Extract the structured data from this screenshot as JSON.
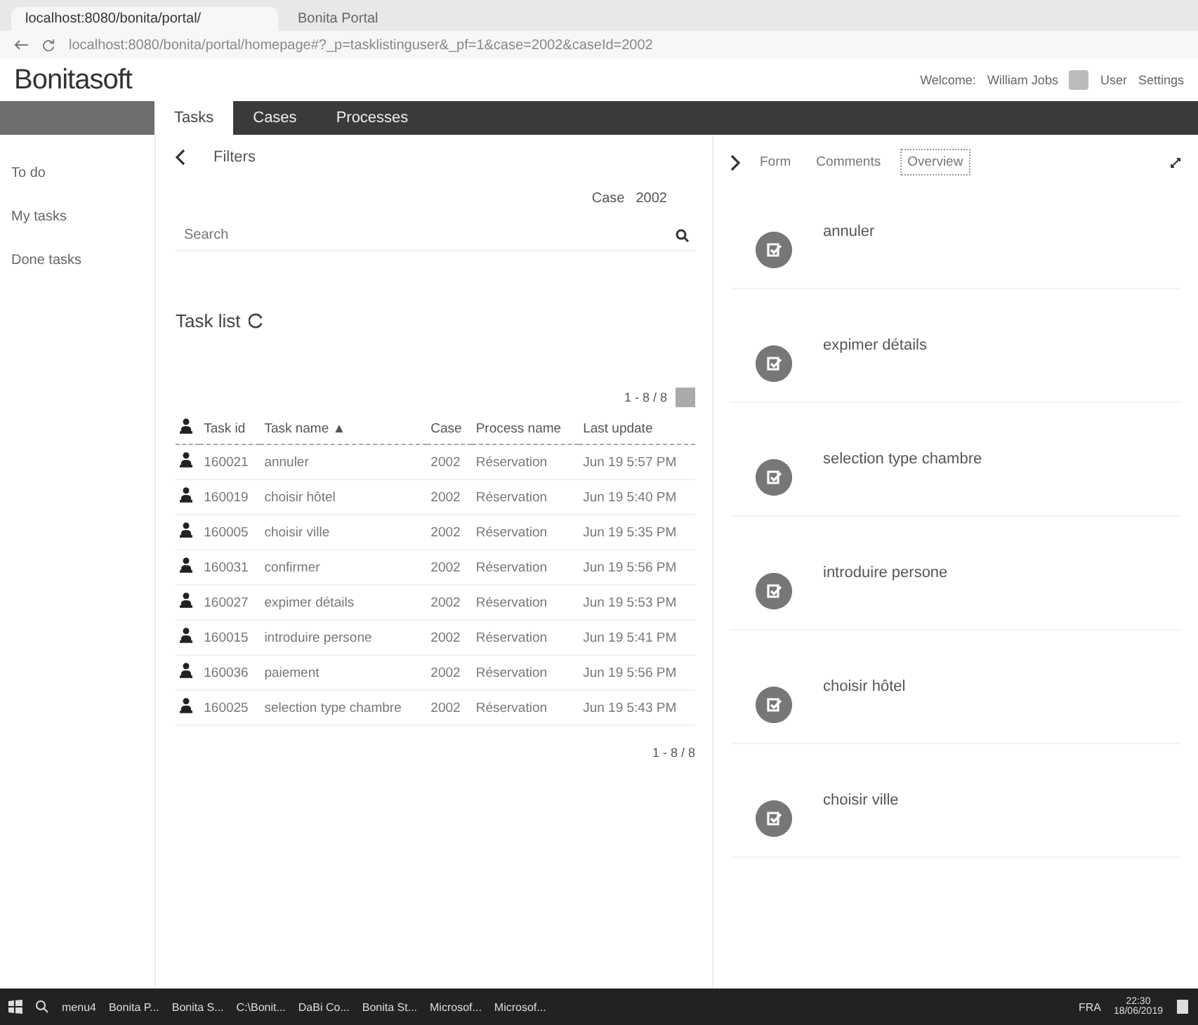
{
  "browser": {
    "tabs": [
      {
        "title": "localhost:8080/bonita/portal/",
        "selected": true
      },
      {
        "title": "Bonita Portal",
        "selected": false
      }
    ],
    "url": "localhost:8080/bonita/portal/homepage#?_p=tasklistinguser&_pf=1&case=2002&caseId=2002"
  },
  "header": {
    "logo": "Bonitasoft",
    "welcome": "Welcome:",
    "user": "William Jobs",
    "app": "User",
    "settings": "Settings"
  },
  "nav": {
    "tabs": [
      {
        "label": "Tasks",
        "selected": true
      },
      {
        "label": "Cases",
        "selected": false
      },
      {
        "label": "Processes",
        "selected": false
      }
    ]
  },
  "sidebar": {
    "items": [
      {
        "label": "To do",
        "selected": false
      },
      {
        "label": "My tasks",
        "selected": false
      },
      {
        "label": "Done tasks",
        "selected": false
      }
    ]
  },
  "filters": {
    "title": "Filters",
    "case_label": "Case",
    "case_value": "2002",
    "search": {
      "placeholder": "Search"
    }
  },
  "task_list": {
    "title": "Task list",
    "pager": "1 - 8 / 8",
    "footer": "1 - 8 / 8",
    "columns": [
      "Task id",
      "Task name",
      "Case",
      "Process name",
      "Last update"
    ],
    "sort_mark": "▲",
    "rows": [
      {
        "id": "160021",
        "name": "annuler",
        "case": "2002",
        "process": "Réservation",
        "updated": "Jun 19 5:57 PM"
      },
      {
        "id": "160019",
        "name": "choisir hôtel",
        "case": "2002",
        "process": "Réservation",
        "updated": "Jun 19 5:40 PM"
      },
      {
        "id": "160005",
        "name": "choisir ville",
        "case": "2002",
        "process": "Réservation",
        "updated": "Jun 19 5:35 PM"
      },
      {
        "id": "160031",
        "name": "confirmer",
        "case": "2002",
        "process": "Réservation",
        "updated": "Jun 19 5:56 PM"
      },
      {
        "id": "160027",
        "name": "expimer détails",
        "case": "2002",
        "process": "Réservation",
        "updated": "Jun 19 5:53 PM"
      },
      {
        "id": "160015",
        "name": "introduire persone",
        "case": "2002",
        "process": "Réservation",
        "updated": "Jun 19 5:41 PM"
      },
      {
        "id": "160036",
        "name": "paiement",
        "case": "2002",
        "process": "Réservation",
        "updated": "Jun 19 5:56 PM"
      },
      {
        "id": "160025",
        "name": "selection type chambre",
        "case": "2002",
        "process": "Réservation",
        "updated": "Jun 19 5:43 PM"
      }
    ]
  },
  "detail": {
    "tabs": [
      {
        "label": "Form",
        "selected": false
      },
      {
        "label": "Comments",
        "selected": false
      },
      {
        "label": "Overview",
        "selected": true
      }
    ],
    "timeline": [
      {
        "name": "annuler"
      },
      {
        "name": "expimer détails"
      },
      {
        "name": "selection type chambre"
      },
      {
        "name": "introduire persone"
      },
      {
        "name": "choisir hôtel"
      },
      {
        "name": "choisir ville"
      }
    ]
  },
  "taskbar": {
    "items": [
      "menu4",
      "Bonita P...",
      "Bonita S...",
      "C:\\Bonit...",
      "DaBi Co...",
      "Bonita St...",
      "Microsof...",
      "Microsof..."
    ],
    "language": "FRA",
    "time": "22:30",
    "date": "18/06/2019"
  }
}
